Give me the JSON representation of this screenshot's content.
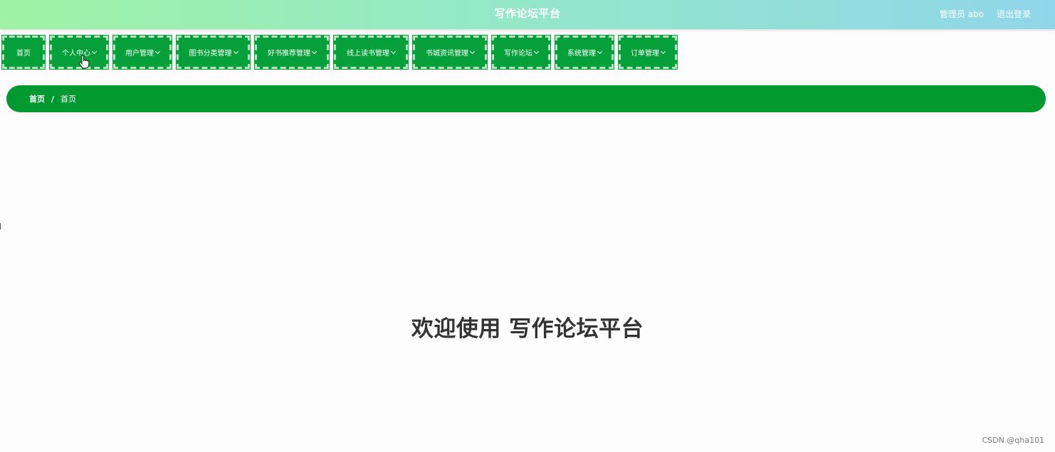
{
  "header": {
    "title": "写作论坛平台",
    "user_label": "管理员 abo",
    "logout_label": "退出登录"
  },
  "nav": {
    "items": [
      {
        "label": "首页",
        "has_dropdown": false
      },
      {
        "label": "个人中心",
        "has_dropdown": true
      },
      {
        "label": "用户管理",
        "has_dropdown": true
      },
      {
        "label": "图书分类管理",
        "has_dropdown": true
      },
      {
        "label": "好书推荐管理",
        "has_dropdown": true
      },
      {
        "label": "线上读书管理",
        "has_dropdown": true
      },
      {
        "label": "书城资讯管理",
        "has_dropdown": true
      },
      {
        "label": "写作论坛",
        "has_dropdown": true
      },
      {
        "label": "系统管理",
        "has_dropdown": true
      },
      {
        "label": "订单管理",
        "has_dropdown": true
      }
    ]
  },
  "breadcrumb": {
    "root": "首页",
    "separator": "/",
    "current": "首页"
  },
  "main": {
    "welcome": "欢迎使用 写作论坛平台"
  },
  "watermark": "CSDN @qha101",
  "colors": {
    "primary_green": "#019930",
    "nav_green": "#06a03a",
    "header_gradient_start": "#9ff2a4",
    "header_gradient_end": "#8fd6ea"
  }
}
